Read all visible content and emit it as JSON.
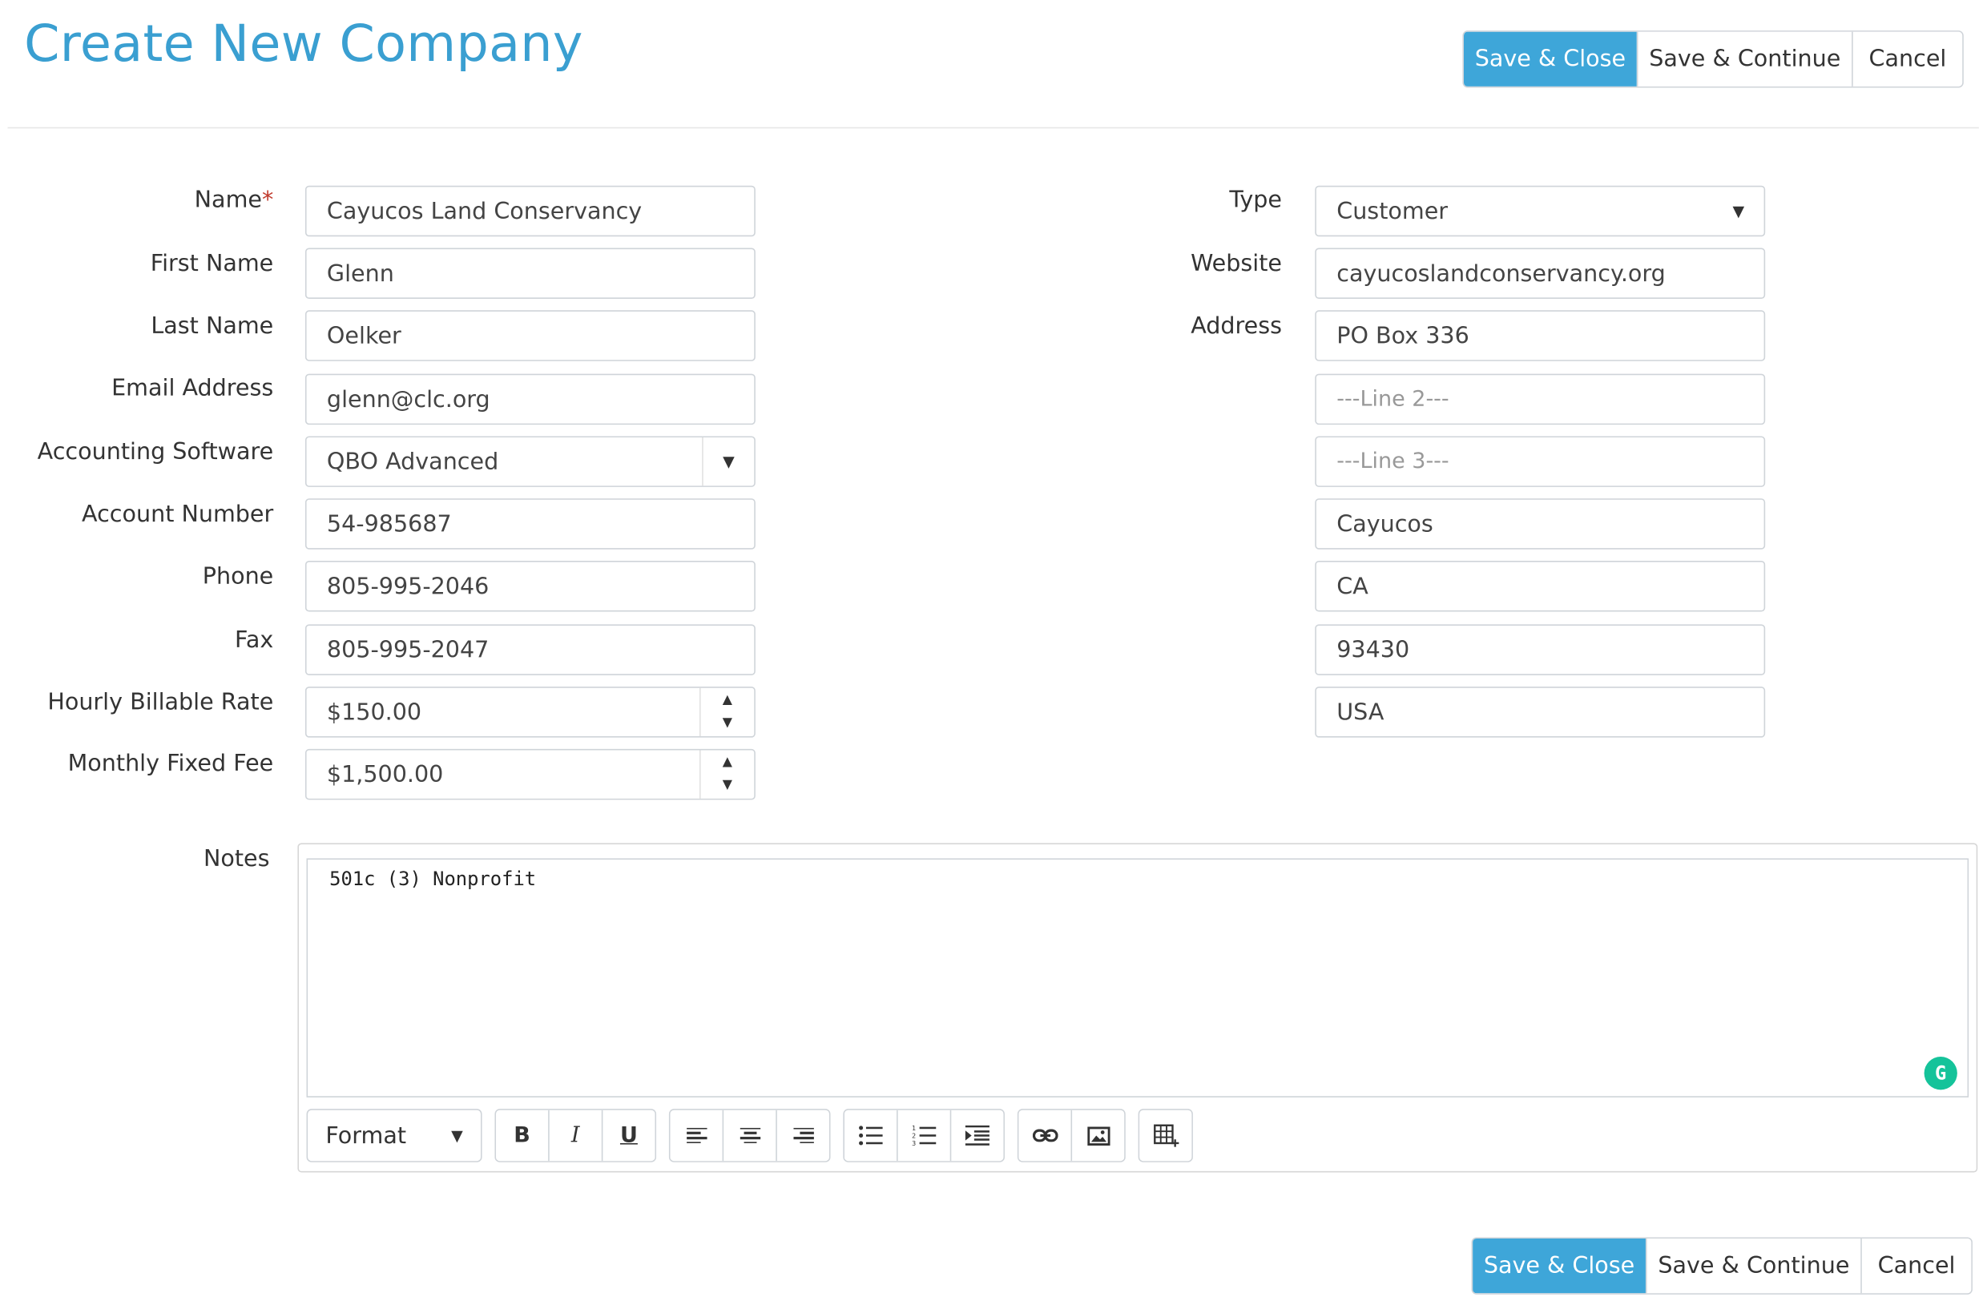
{
  "header": {
    "title": "Create New Company",
    "actions": {
      "save_close": "Save & Close",
      "save_continue": "Save & Continue",
      "cancel": "Cancel"
    }
  },
  "form": {
    "name": {
      "label": "Name",
      "required_mark": "*",
      "value": "Cayucos Land Conservancy"
    },
    "first_name": {
      "label": "First Name",
      "value": "Glenn"
    },
    "last_name": {
      "label": "Last Name",
      "value": "Oelker"
    },
    "email": {
      "label": "Email Address",
      "value": "glenn@clc.org"
    },
    "accounting_software": {
      "label": "Accounting Software",
      "value": "QBO Advanced"
    },
    "account_number": {
      "label": "Account Number",
      "value": "54-985687"
    },
    "phone": {
      "label": "Phone",
      "value": "805-995-2046"
    },
    "fax": {
      "label": "Fax",
      "value": "805-995-2047"
    },
    "hourly_rate": {
      "label": "Hourly Billable Rate",
      "value": "$150.00"
    },
    "monthly_fee": {
      "label": "Monthly Fixed Fee",
      "value": "$1,500.00"
    },
    "type": {
      "label": "Type",
      "value": "Customer"
    },
    "website": {
      "label": "Website",
      "value": "cayucoslandconservancy.org"
    },
    "address": {
      "label": "Address",
      "line1": "PO Box 336",
      "line2_placeholder": "---Line 2---",
      "line3_placeholder": "---Line 3---",
      "city": "Cayucos",
      "state": "CA",
      "zip": "93430",
      "country": "USA"
    },
    "notes": {
      "label": "Notes",
      "value": "501c (3) Nonprofit",
      "format_label": "Format"
    }
  },
  "icons": {
    "caret": "▼",
    "spin_up": "▲",
    "spin_down": "▼",
    "grammarly": "grammarly-icon",
    "bold": "B",
    "italic": "I",
    "underline": "U"
  },
  "colors": {
    "primary": "#3ea6d9",
    "title": "#3a9fd1",
    "required": "#c0392b",
    "grammarly": "#15c39a"
  },
  "footer": {
    "actions": {
      "save_close": "Save & Close",
      "save_continue": "Save & Continue",
      "cancel": "Cancel"
    }
  }
}
